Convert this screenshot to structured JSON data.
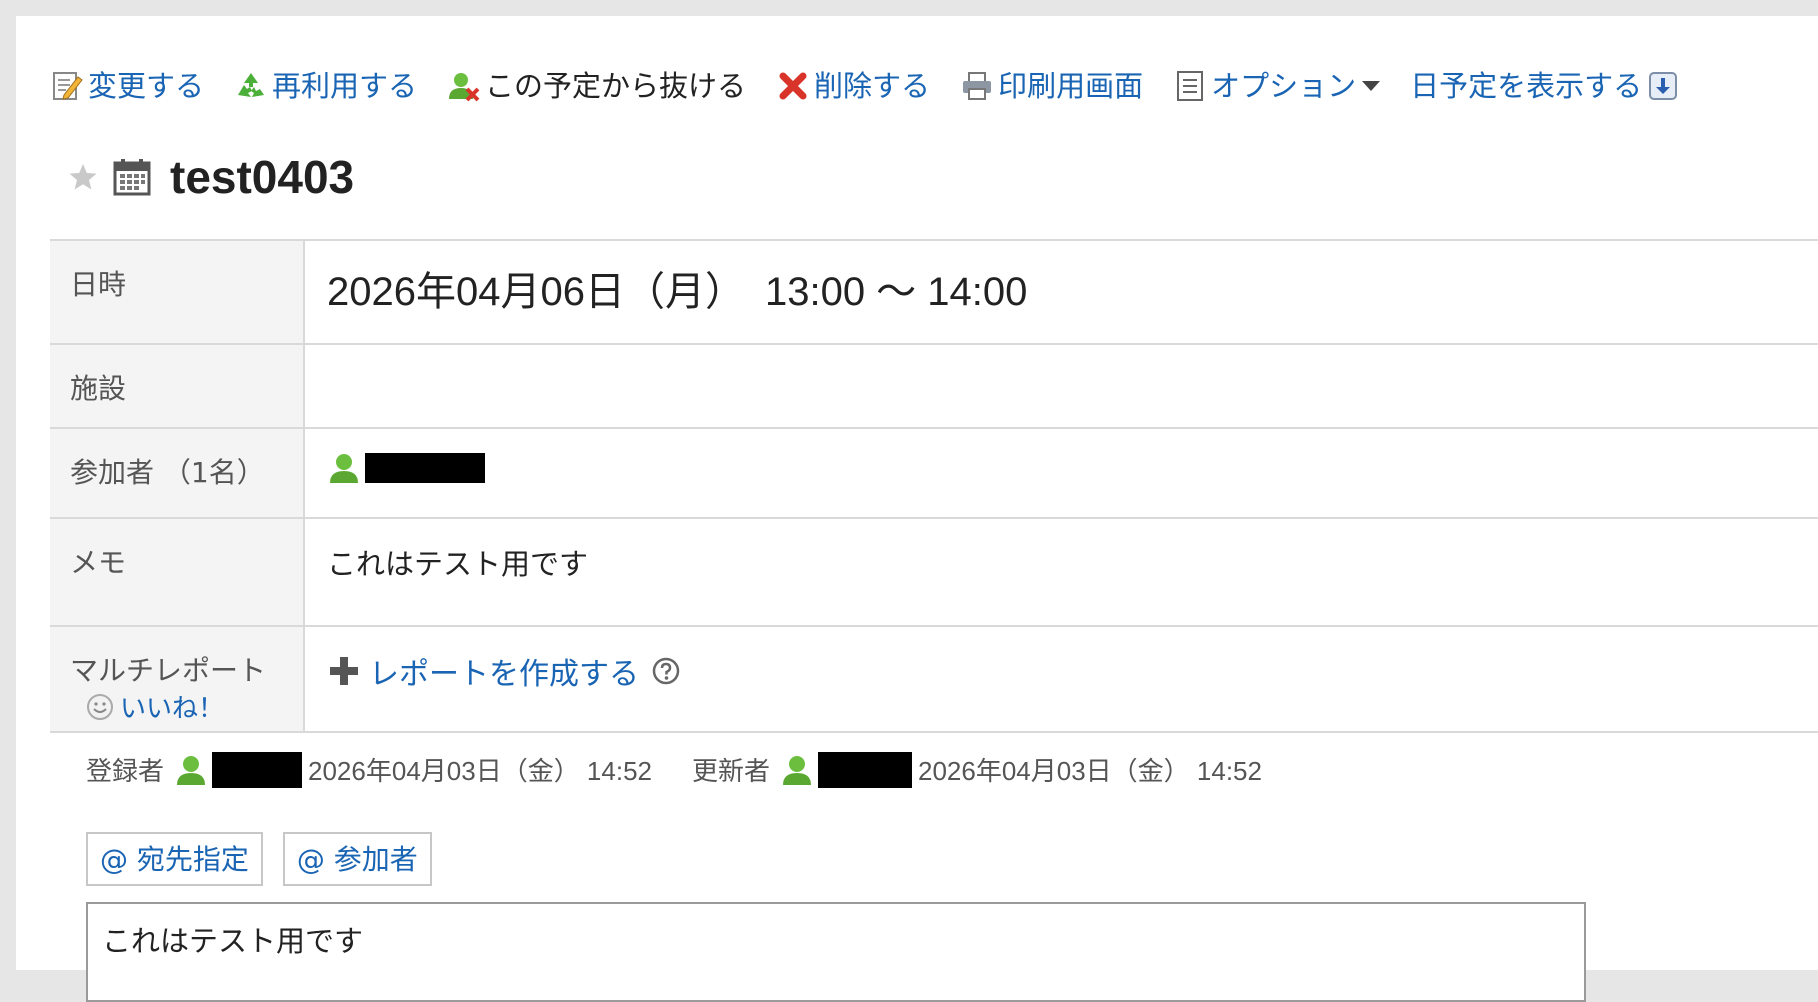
{
  "toolbar": {
    "change": "変更する",
    "reuse": "再利用する",
    "leave": "この予定から抜ける",
    "delete": "削除する",
    "print": "印刷用画面",
    "options": "オプション",
    "show_day": "日予定を表示する"
  },
  "event": {
    "title": "test0403"
  },
  "details": {
    "datetime_label": "日時",
    "datetime_value": "2026年04月06日（月）　13:00 〜 14:00",
    "facility_label": "施設",
    "facility_value": "",
    "participants_label": "参加者 （1名）",
    "memo_label": "メモ",
    "memo_value": "これはテスト用です",
    "multireport_label": "マルチレポート",
    "create_report": "レポートを作成する"
  },
  "like": {
    "label": "いいね！"
  },
  "meta": {
    "registered_label": "登録者",
    "registered_date": "2026年04月03日（金） 14:52",
    "updated_label": "更新者",
    "updated_date": "2026年04月03日（金） 14:52"
  },
  "mentions": {
    "recipient": "@ 宛先指定",
    "participants": "@ 参加者"
  },
  "comment": {
    "value": "これはテスト用です"
  },
  "colors": {
    "link": "#1a64b4",
    "label_bg": "#f4f4f4",
    "border": "#d9d9d9",
    "user_icon": "#5aa832"
  },
  "icons": [
    "memo-edit-icon",
    "recycle-icon",
    "user-remove-icon",
    "delete-x-icon",
    "printer-icon",
    "options-list-icon",
    "download-icon",
    "star-icon",
    "calendar-icon",
    "user-icon",
    "plus-icon",
    "help-icon",
    "smile-icon"
  ]
}
